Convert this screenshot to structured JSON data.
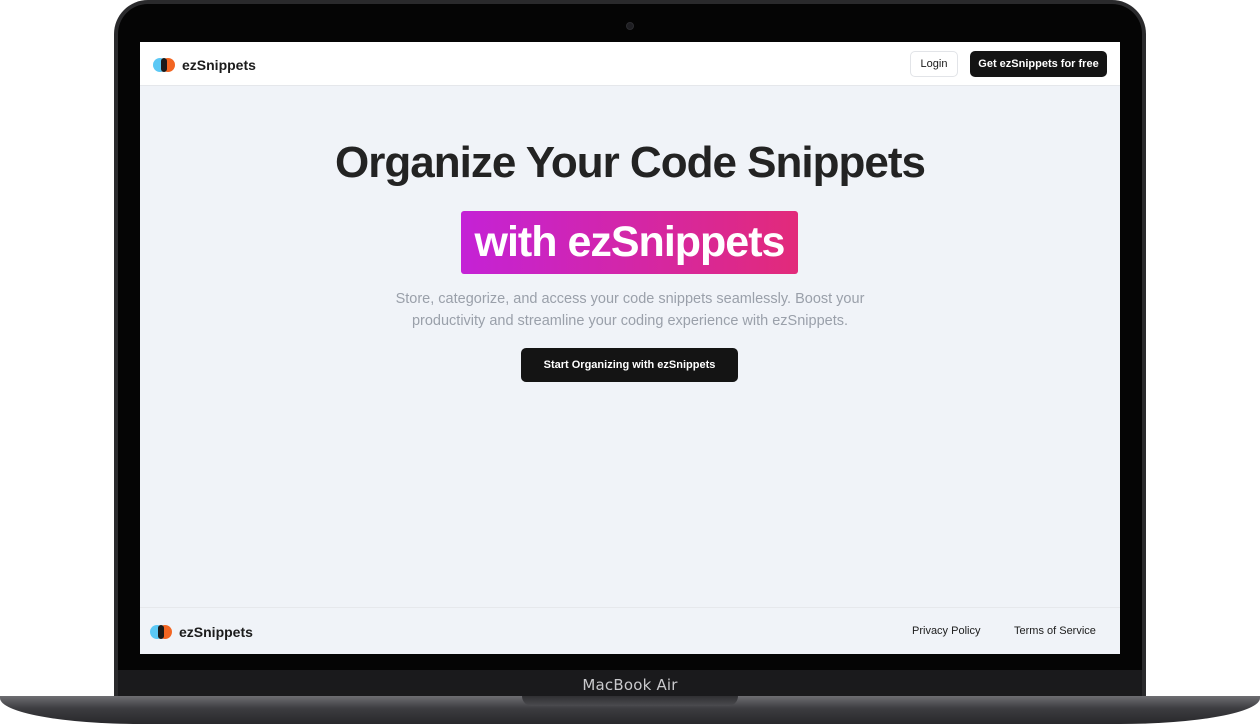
{
  "device": {
    "model_label": "MacBook Air"
  },
  "header": {
    "brand_name": "ezSnippets",
    "login_label": "Login",
    "get_started_label": "Get ezSnippets for free"
  },
  "hero": {
    "title": "Organize Your Code Snippets",
    "highlight": "with ezSnippets",
    "subtitle": "Store, categorize, and access your code snippets seamlessly. Boost your productivity and streamline your coding experience with ezSnippets.",
    "cta_label": "Start Organizing with ezSnippets"
  },
  "footer": {
    "brand_name": "ezSnippets",
    "links": [
      "Privacy Policy",
      "Terms of Service"
    ]
  },
  "colors": {
    "highlight_start": "#c422d6",
    "highlight_end": "#e22a7a",
    "logo_blue": "#5bc8f5",
    "logo_orange": "#f26522",
    "button_dark": "#141414",
    "page_background": "#f0f3f8"
  },
  "icons": {
    "logo": "ezsnippets-logo-icon"
  }
}
